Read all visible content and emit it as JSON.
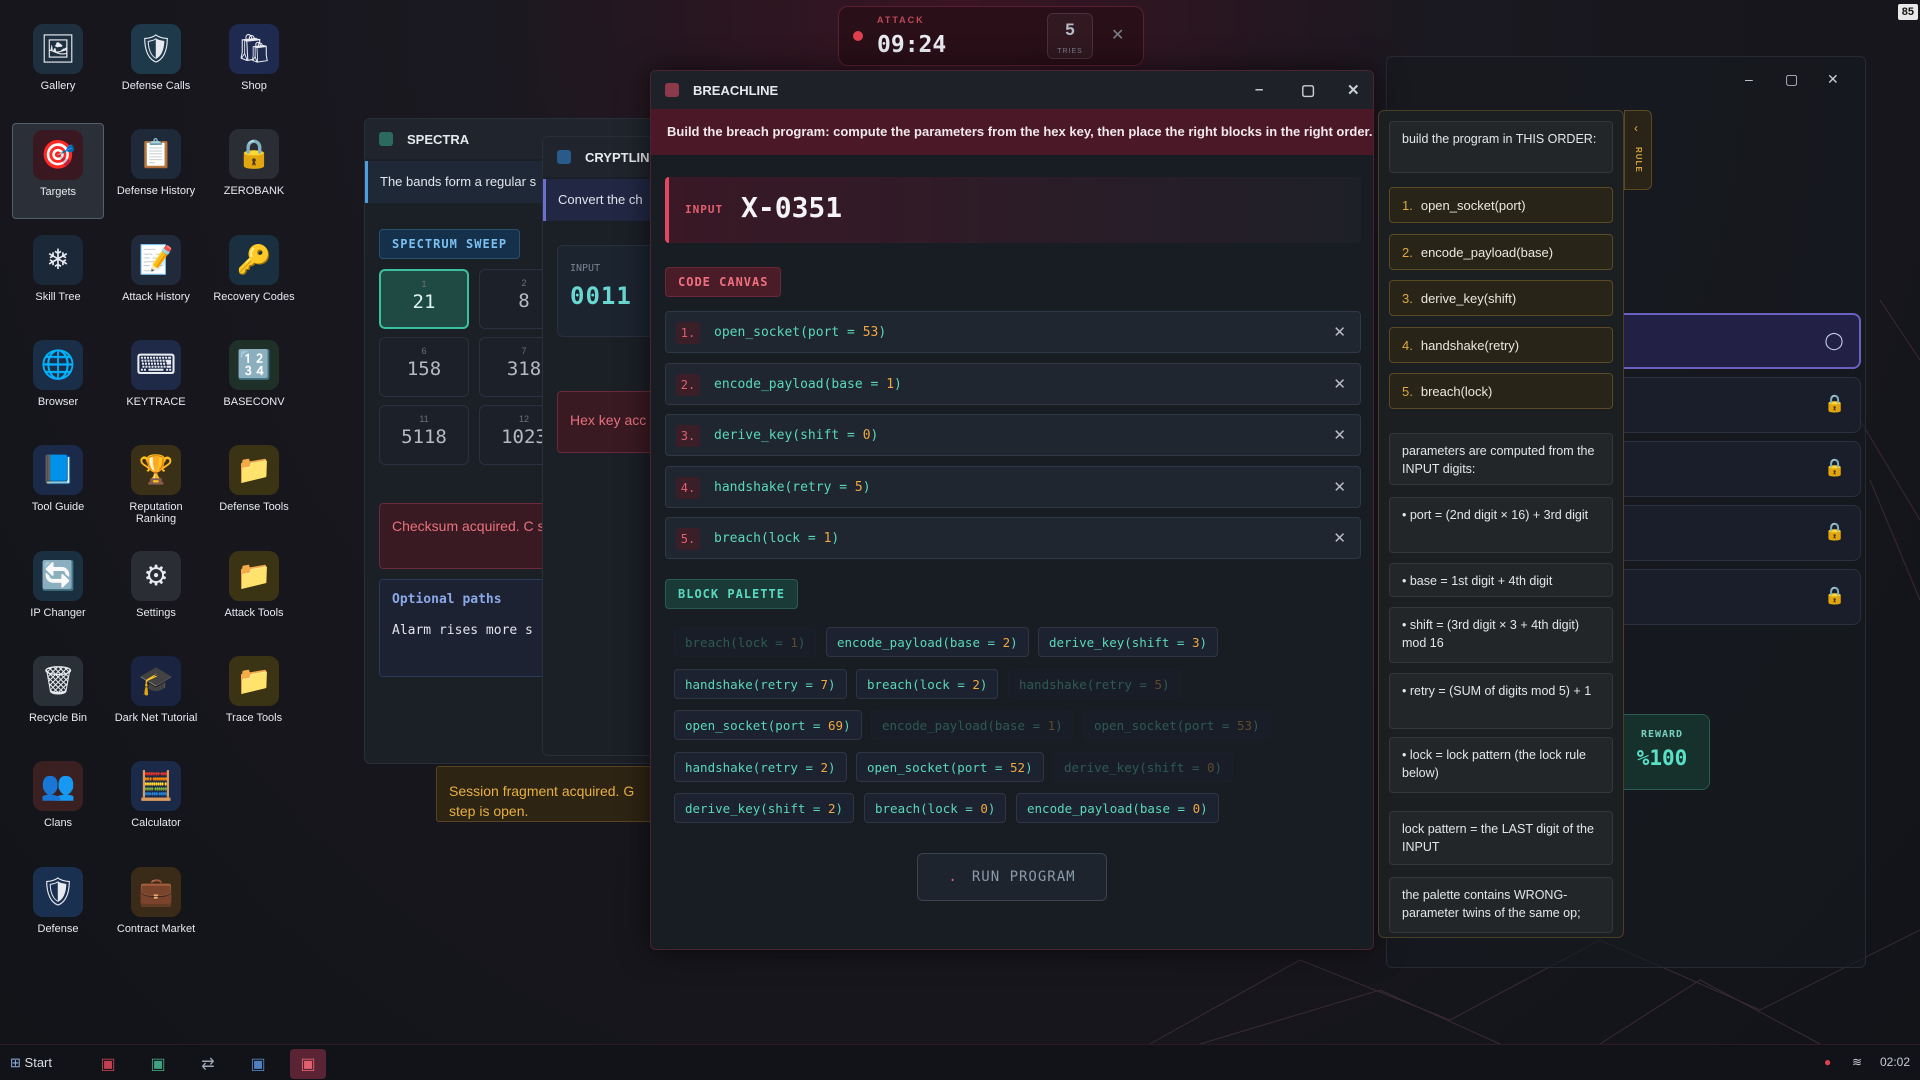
{
  "desktop": {
    "icons": [
      {
        "label": "Gallery",
        "glyph": "🖼",
        "name": "gallery"
      },
      {
        "label": "Defense Calls",
        "glyph": "🛡",
        "name": "defense-calls"
      },
      {
        "label": "Shop",
        "glyph": "🛍",
        "name": "shop"
      },
      {
        "label": "Targets",
        "glyph": "🎯",
        "name": "targets"
      },
      {
        "label": "Defense History",
        "glyph": "📋",
        "name": "defense-history"
      },
      {
        "label": "ZEROBANK",
        "glyph": "🔒",
        "name": "zerobank"
      },
      {
        "label": "Skill Tree",
        "glyph": "❄",
        "name": "skill-tree"
      },
      {
        "label": "Attack History",
        "glyph": "📝",
        "name": "attack-history"
      },
      {
        "label": "Recovery Codes",
        "glyph": "🔑",
        "name": "recovery-codes"
      },
      {
        "label": "Browser",
        "glyph": "🌐",
        "name": "browser"
      },
      {
        "label": "KEYTRACE",
        "glyph": "⌨",
        "name": "keytrace"
      },
      {
        "label": "BASECONV",
        "glyph": "🔢",
        "name": "baseconv"
      },
      {
        "label": "Tool Guide",
        "glyph": "📘",
        "name": "tool-guide"
      },
      {
        "label": "Reputation Ranking",
        "glyph": "🏆",
        "name": "reputation-ranking"
      },
      {
        "label": "Defense Tools",
        "glyph": "📁",
        "name": "defense-tools"
      },
      {
        "label": "IP Changer",
        "glyph": "🔄",
        "name": "ip-changer"
      },
      {
        "label": "Settings",
        "glyph": "⚙",
        "name": "settings"
      },
      {
        "label": "Attack Tools",
        "glyph": "📁",
        "name": "attack-tools"
      },
      {
        "label": "Recycle Bin",
        "glyph": "🗑",
        "name": "recycle-bin"
      },
      {
        "label": "Dark Net Tutorial",
        "glyph": "🎓",
        "name": "dark-net-tutorial"
      },
      {
        "label": "Trace Tools",
        "glyph": "📁",
        "name": "trace-tools"
      },
      {
        "label": "Clans",
        "glyph": "👥",
        "name": "clans"
      },
      {
        "label": "Calculator",
        "glyph": "🧮",
        "name": "calculator"
      },
      {
        "label": "Defense",
        "glyph": "🛡",
        "name": "defense"
      },
      {
        "label": "Contract Market",
        "glyph": "💼",
        "name": "contract-market"
      }
    ]
  },
  "attack_timer": {
    "label": "ATTACK",
    "time": "09:24",
    "tries_count": "5",
    "tries_label": "TRIES",
    "close": "✕"
  },
  "spectra": {
    "title": "SPECTRA",
    "description": "The bands form a regular s",
    "sweep_label": "SPECTRUM SWEEP",
    "cells": [
      {
        "index": "1",
        "value": "21"
      },
      {
        "index": "2",
        "value": "8"
      },
      {
        "index": "6",
        "value": "158"
      },
      {
        "index": "7",
        "value": "318"
      },
      {
        "index": "11",
        "value": "5118"
      },
      {
        "index": "12",
        "value": "1023"
      }
    ],
    "checksum": "Checksum acquired. C signature.",
    "optional_title": "Optional paths",
    "optional_text": "Alarm rises more s"
  },
  "cryptline": {
    "title": "CRYPTLINE",
    "description": "Convert the ch",
    "input_label": "INPUT",
    "input_value": "0011",
    "hex_key_msg": "Hex key acc"
  },
  "session_fragment": "Session fragment acquired. G step is open.",
  "reward": {
    "label": "REWARD",
    "value": "%100"
  },
  "breachline": {
    "title": "BREACHLINE",
    "instructions": "Build the breach program: compute the parameters from the hex key, then place the right blocks in the right order.",
    "input_label": "INPUT",
    "input_value": "X-0351",
    "canvas_label": "CODE CANVAS",
    "canvas_rows": [
      {
        "n": "1.",
        "fn": "open_socket(port = ",
        "val": "53",
        "tail": ")"
      },
      {
        "n": "2.",
        "fn": "encode_payload(base = ",
        "val": "1",
        "tail": ")"
      },
      {
        "n": "3.",
        "fn": "derive_key(shift = ",
        "val": "0",
        "tail": ")"
      },
      {
        "n": "4.",
        "fn": "handshake(retry = ",
        "val": "5",
        "tail": ")"
      },
      {
        "n": "5.",
        "fn": "breach(lock = ",
        "val": "1",
        "tail": ")"
      }
    ],
    "remove_glyph": "✕",
    "palette_label": "BLOCK PALETTE",
    "palette_rows": [
      [
        {
          "fn": "breach(lock = ",
          "val": "1",
          "dim": true
        },
        {
          "fn": "encode_payload(base = ",
          "val": "2",
          "dim": false
        },
        {
          "fn": "derive_key(shift = ",
          "val": "3",
          "dim": false
        }
      ],
      [
        {
          "fn": "handshake(retry = ",
          "val": "7",
          "dim": false
        },
        {
          "fn": "breach(lock = ",
          "val": "2",
          "dim": false
        },
        {
          "fn": "handshake(retry = ",
          "val": "5",
          "dim": true
        }
      ],
      [
        {
          "fn": "open_socket(port = ",
          "val": "69",
          "dim": false
        },
        {
          "fn": "encode_payload(base = ",
          "val": "1",
          "dim": true
        },
        {
          "fn": "open_socket(port = ",
          "val": "53",
          "dim": true
        }
      ],
      [
        {
          "fn": "handshake(retry = ",
          "val": "2",
          "dim": false
        },
        {
          "fn": "open_socket(port = ",
          "val": "52",
          "dim": false
        },
        {
          "fn": "derive_key(shift = ",
          "val": "0",
          "dim": true
        }
      ],
      [
        {
          "fn": "derive_key(shift = ",
          "val": "2",
          "dim": false
        },
        {
          "fn": "breach(lock = ",
          "val": "0",
          "dim": false
        },
        {
          "fn": "encode_payload(base = ",
          "val": "0",
          "dim": false
        }
      ]
    ],
    "run_label": "RUN PROGRAM",
    "run_dot": "."
  },
  "rules": {
    "tab_label": "RULE",
    "tab_arrow": "‹",
    "intro": "build the program in THIS ORDER:",
    "steps": [
      {
        "n": "1.",
        "text": "open_socket(port)"
      },
      {
        "n": "2.",
        "text": "encode_payload(base)"
      },
      {
        "n": "3.",
        "text": "derive_key(shift)"
      },
      {
        "n": "4.",
        "text": "handshake(retry)"
      },
      {
        "n": "5.",
        "text": "breach(lock)"
      }
    ],
    "params_intro": "parameters are computed from the INPUT digits:",
    "params": [
      "• port = (2nd digit × 16) + 3rd digit",
      "• base = 1st digit + 4th digit",
      "• shift = (3rd digit × 3 + 4th digit) mod 16",
      "• retry = (SUM of digits mod 5) + 1",
      "• lock = lock pattern (the lock rule below)"
    ],
    "lock_pattern": "lock pattern = the LAST digit of the INPUT",
    "palette_note": "the palette contains WRONG-parameter twins of the same op;"
  },
  "window_controls": {
    "minimize": "–",
    "maximize": "▢",
    "close": "✕"
  },
  "taskbar": {
    "start": "Start",
    "time": "02:02",
    "corner": "85"
  },
  "colors": {
    "accent_red": "#e04860",
    "accent_teal": "#5ad8b8",
    "accent_amber": "#e0a840"
  }
}
